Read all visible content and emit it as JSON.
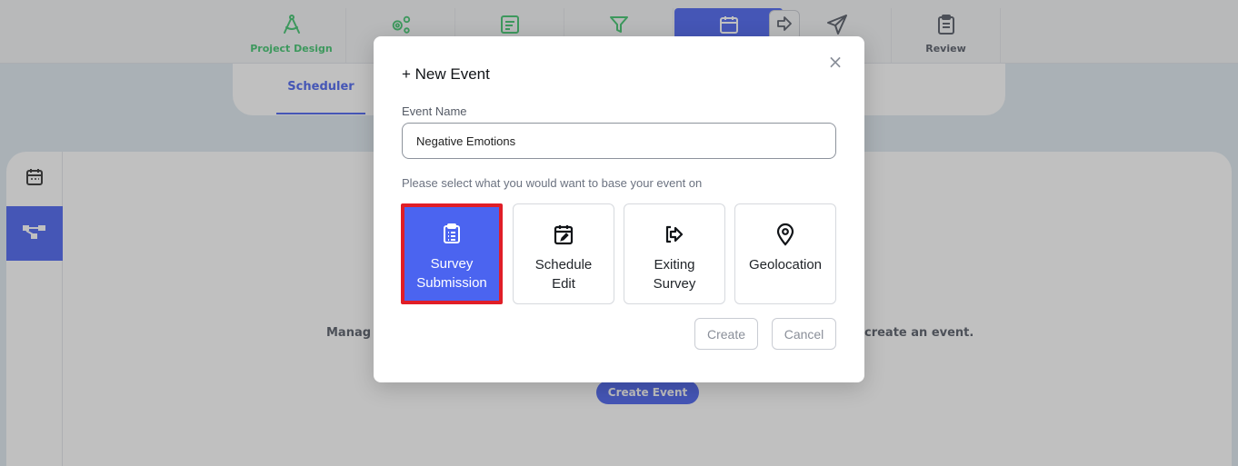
{
  "nav": {
    "items": [
      {
        "label": "Project Design",
        "icon": "compass-icon",
        "color": "#3ec46d"
      },
      {
        "label": "Review",
        "icon": "clipboard-icon",
        "color": "#555b66"
      }
    ]
  },
  "subtabs": {
    "active": "Scheduler"
  },
  "background": {
    "message_left": "Manag",
    "message_right": "create an event.",
    "create_event_button": "Create Event"
  },
  "modal": {
    "title": "+ New Event",
    "close_glyph": "×",
    "event_name_label": "Event Name",
    "event_name_value": "Negative Emotions",
    "prompt": "Please select what you would want to base your event on",
    "options": [
      {
        "label": "Survey Submission",
        "icon": "clipboard-list-icon",
        "selected": true
      },
      {
        "label": "Schedule Edit",
        "icon": "calendar-edit-icon",
        "selected": false
      },
      {
        "label": "Exiting Survey",
        "icon": "exit-arrow-icon",
        "selected": false
      },
      {
        "label": "Geolocation",
        "icon": "map-pin-icon",
        "selected": false
      }
    ],
    "create_button": "Create",
    "cancel_button": "Cancel"
  },
  "colors": {
    "accent": "#4b64f0",
    "green": "#3ec46d",
    "selected_outline": "#e01e27"
  }
}
